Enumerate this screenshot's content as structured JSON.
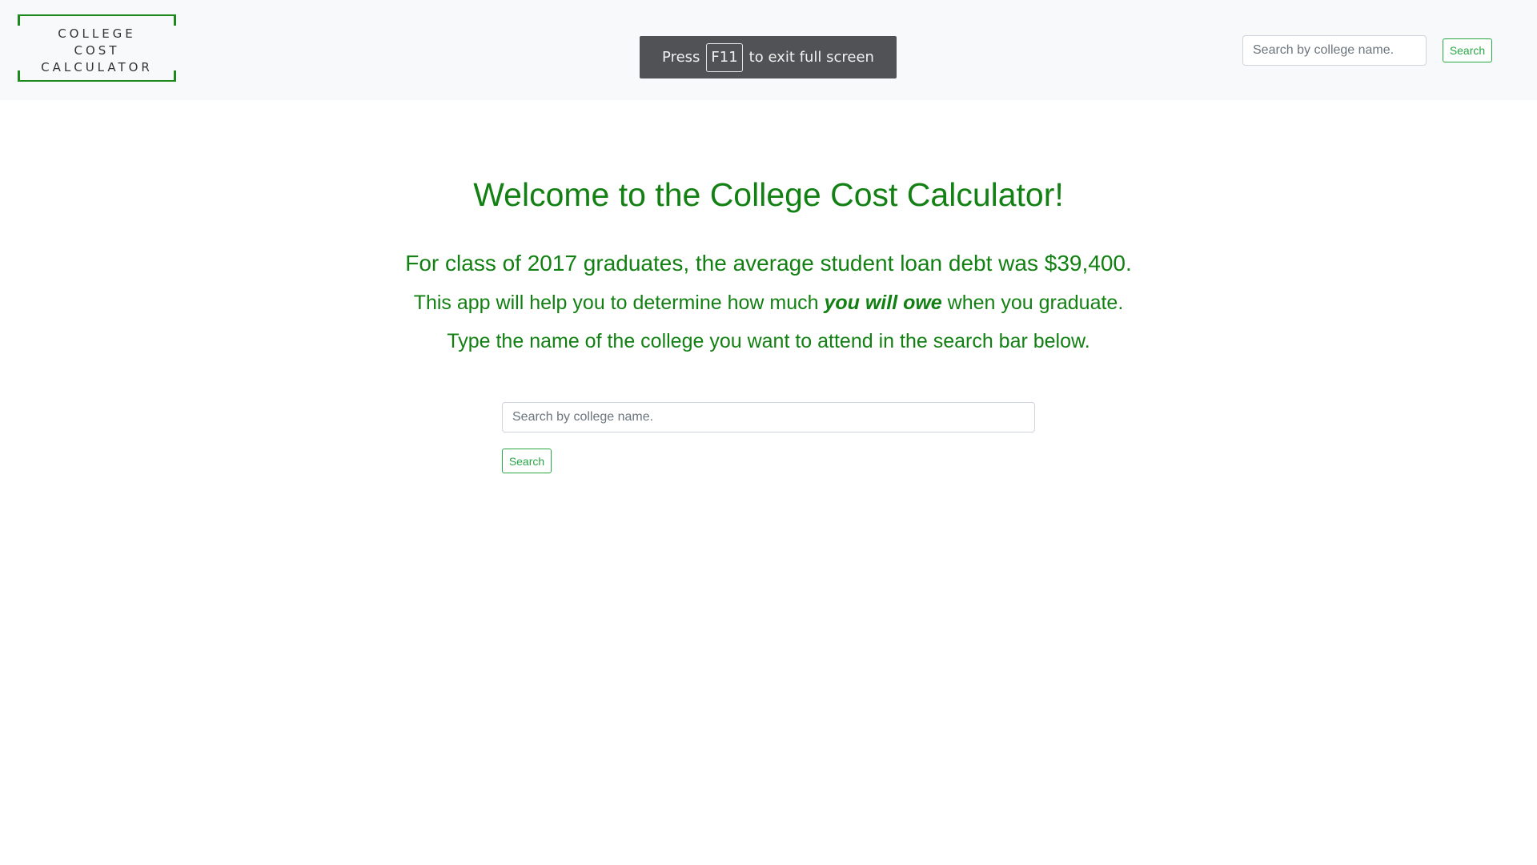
{
  "logo": {
    "lines": [
      "COLLEGE",
      "COST",
      "CALCULATOR"
    ]
  },
  "fullscreen_toast": {
    "prefix": "Press",
    "key": "F11",
    "suffix": "to exit full screen"
  },
  "navbar": {
    "search_placeholder": "Search by college name.",
    "search_button": "Search"
  },
  "main": {
    "headline": "Welcome to the College Cost Calculator!",
    "debt_line": "For class of 2017 graduates, the average student loan debt was $39,400.",
    "help_line_before": "This app will help you to determine how much ",
    "help_line_emphasis": "you will owe",
    "help_line_after": " when you graduate.",
    "instruction_line": "Type the name of the college you want to attend in the search bar below.",
    "search_placeholder": "Search by college name.",
    "search_button": "Search"
  },
  "colors": {
    "brand_green": "#128012",
    "button_green": "#28a745",
    "navbar_bg": "#f8f9fa",
    "toast_bg": "#505255"
  }
}
